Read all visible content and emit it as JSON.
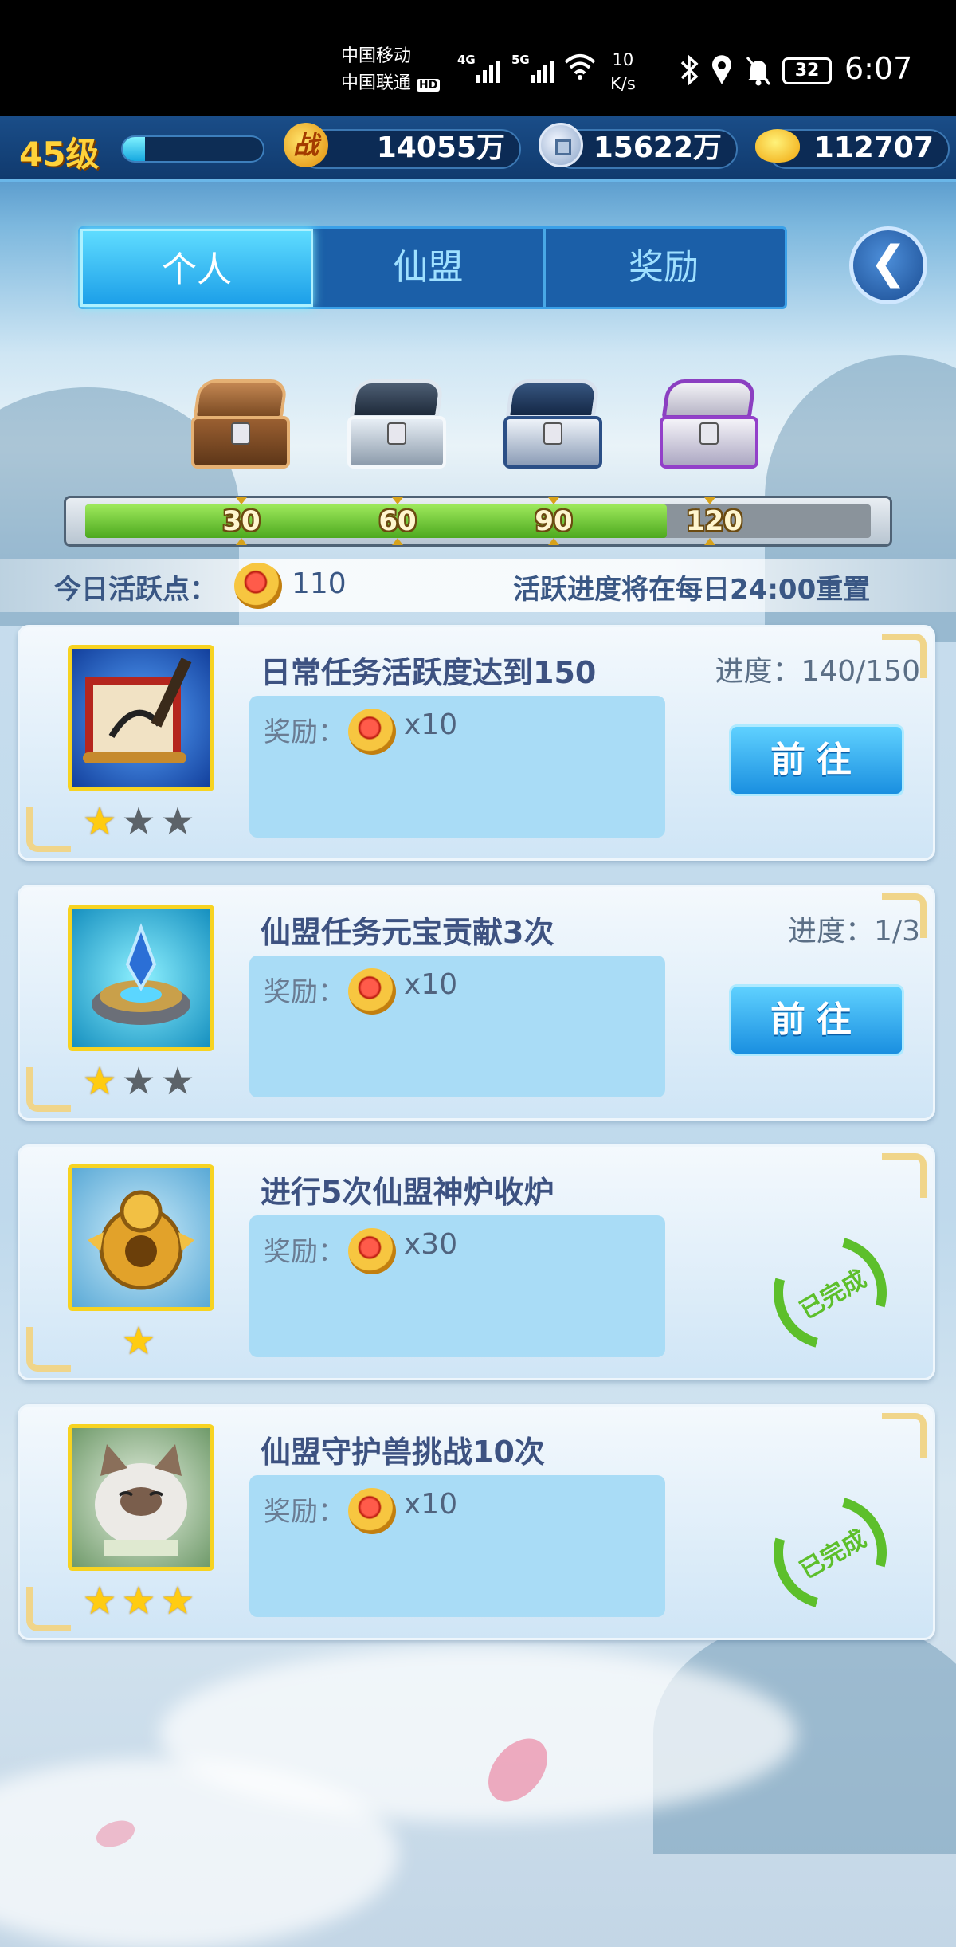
{
  "status_bar": {
    "carrier_1": "中国移动",
    "carrier_2": "中国联通",
    "hd_badge": "HD",
    "net_1": "4G",
    "net_2": "5G",
    "speed_value": "10",
    "speed_unit": "K/s",
    "battery": "32",
    "time": "6:07"
  },
  "top_bar": {
    "level": "45级",
    "xp_fraction": 0.16,
    "combat_power": "14055万",
    "silver": "15622万",
    "gold": "112707",
    "combat_icon_char": "战"
  },
  "tabs": [
    {
      "label": "个人",
      "active": true
    },
    {
      "label": "仙盟",
      "active": false
    },
    {
      "label": "奖励",
      "active": false
    }
  ],
  "back_button_icon": "back-arrow-icon",
  "activity": {
    "chests": [
      "wooden-chest",
      "silver-chest",
      "blue-chest",
      "purple-chest"
    ],
    "milestones": [
      "30",
      "60",
      "90",
      "120"
    ],
    "progress_fraction": 0.74,
    "today_label": "今日活跃点：",
    "today_value": "110",
    "reset_note": "活跃进度将在每日24:00重置"
  },
  "tasks": [
    {
      "title": "日常任务活跃度达到150",
      "progress": "进度：140/150",
      "reward_label": "奖励：",
      "reward_qty": "x10",
      "stars": 1,
      "status": "go",
      "button_label": "前往",
      "icon": "scroll-brush-icon"
    },
    {
      "title": "仙盟任务元宝贡献3次",
      "progress": "进度：1/3",
      "reward_label": "奖励：",
      "reward_qty": "x10",
      "stars": 1,
      "status": "go",
      "button_label": "前往",
      "icon": "crystal-altar-icon"
    },
    {
      "title": "进行5次仙盟神炉收炉",
      "progress": "",
      "reward_label": "奖励：",
      "reward_qty": "x30",
      "stars": 1,
      "status": "done",
      "done_label": "已完成",
      "icon": "golden-furnace-icon"
    },
    {
      "title": "仙盟守护兽挑战10次",
      "progress": "",
      "reward_label": "奖励：",
      "reward_qty": "x10",
      "stars": 3,
      "status": "done",
      "done_label": "已完成",
      "icon": "guardian-cat-icon"
    }
  ],
  "colors": {
    "accent_blue": "#1c9fe8",
    "gold_text": "#ffd23a",
    "progress_green": "#4da91f",
    "done_green": "#5dbf2b"
  }
}
